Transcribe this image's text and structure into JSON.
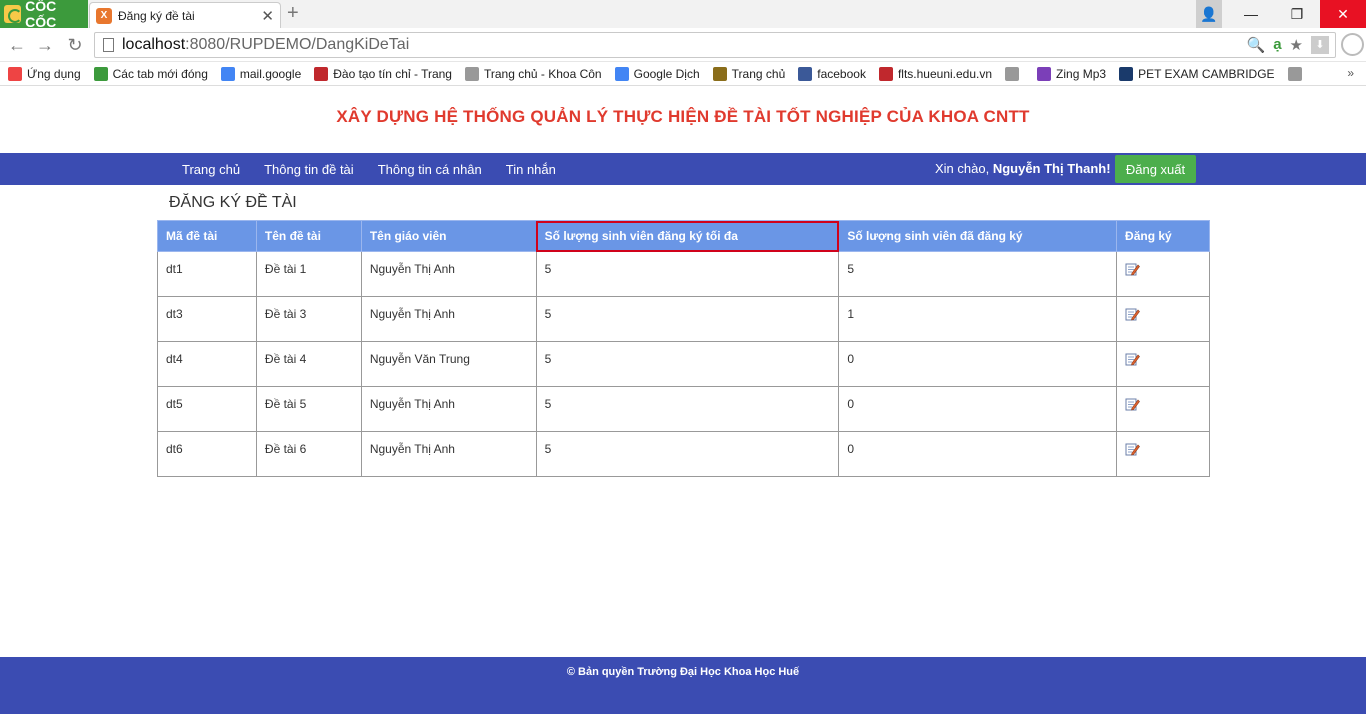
{
  "browser": {
    "logo_text": "CỐC CỐC",
    "tab_title": "Đăng ký đề tài",
    "url_host": "localhost",
    "url_path": ":8080/RUPDEMO/DangKiDeTai",
    "bookmarks": [
      {
        "label": "Ứng dụng",
        "icon": "apps-grid-icon",
        "color": "#e44"
      },
      {
        "label": "Các tab mới đóng",
        "icon": "history-icon",
        "color": "#3c9a3c"
      },
      {
        "label": "mail.google",
        "icon": "google-icon",
        "color": "#4285f4"
      },
      {
        "label": "Đào tạo tín chỉ - Trang",
        "icon": "shield-icon",
        "color": "#c0282d"
      },
      {
        "label": "Trang chủ - Khoa Côn",
        "icon": "page-icon",
        "color": "#999"
      },
      {
        "label": "Google Dịch",
        "icon": "translate-icon",
        "color": "#4285f4"
      },
      {
        "label": "Trang chủ",
        "icon": "school-icon",
        "color": "#8a6d1a"
      },
      {
        "label": "facebook",
        "icon": "facebook-icon",
        "color": "#3b5998"
      },
      {
        "label": "flts.hueuni.edu.vn",
        "icon": "shield-icon",
        "color": "#c0282d"
      },
      {
        "label": "",
        "icon": "page-icon",
        "color": "#999"
      },
      {
        "label": "Zing Mp3",
        "icon": "zing-icon",
        "color": "#7b3fb8"
      },
      {
        "label": "PET EXAM CAMBRIDGE",
        "icon": "book-icon",
        "color": "#1a3a6b"
      },
      {
        "label": "",
        "icon": "page-icon",
        "color": "#999"
      }
    ]
  },
  "header": {
    "site_title": "XÂY DỰNG HỆ THỐNG QUẢN LÝ THỰC HIỆN ĐỀ TÀI TỐT NGHIỆP CỦA KHOA CNTT"
  },
  "nav": {
    "links": [
      "Trang chủ",
      "Thông tin đề tài",
      "Thông tin cá nhân",
      "Tin nhắn"
    ],
    "greeting_prefix": "Xin chào, ",
    "user_name": "Nguyễn Thị Thanh!",
    "logout_label": "Đăng xuất"
  },
  "main": {
    "section_title": "ĐĂNG KÝ ĐỀ TÀI",
    "columns": [
      "Mã đề tài",
      "Tên đề tài",
      "Tên giáo viên",
      "Số lượng sinh viên đăng ký tối đa",
      "Số lượng sinh viên đã đăng ký",
      "Đăng ký"
    ],
    "rows": [
      {
        "id": "dt1",
        "name": "Đề tài 1",
        "teacher": "Nguyễn Thị Anh",
        "max": "5",
        "registered": "5"
      },
      {
        "id": "dt3",
        "name": "Đề tài 3",
        "teacher": "Nguyễn Thị Anh",
        "max": "5",
        "registered": "1"
      },
      {
        "id": "dt4",
        "name": "Đề tài 4",
        "teacher": "Nguyễn Văn Trung",
        "max": "5",
        "registered": "0"
      },
      {
        "id": "dt5",
        "name": "Đề tài 5",
        "teacher": "Nguyễn Thị Anh",
        "max": "5",
        "registered": "0"
      },
      {
        "id": "dt6",
        "name": "Đề tài 6",
        "teacher": "Nguyễn Thị Anh",
        "max": "5",
        "registered": "0"
      }
    ]
  },
  "footer": {
    "text": "© Bản quyền Trường Đại Học Khoa Học Huế"
  },
  "colors": {
    "nav_bg": "#3b4cb2",
    "title_red": "#e03a2e",
    "table_header": "#6a96e6",
    "logout_green": "#4cae4c",
    "highlight_border": "#d0021b"
  }
}
